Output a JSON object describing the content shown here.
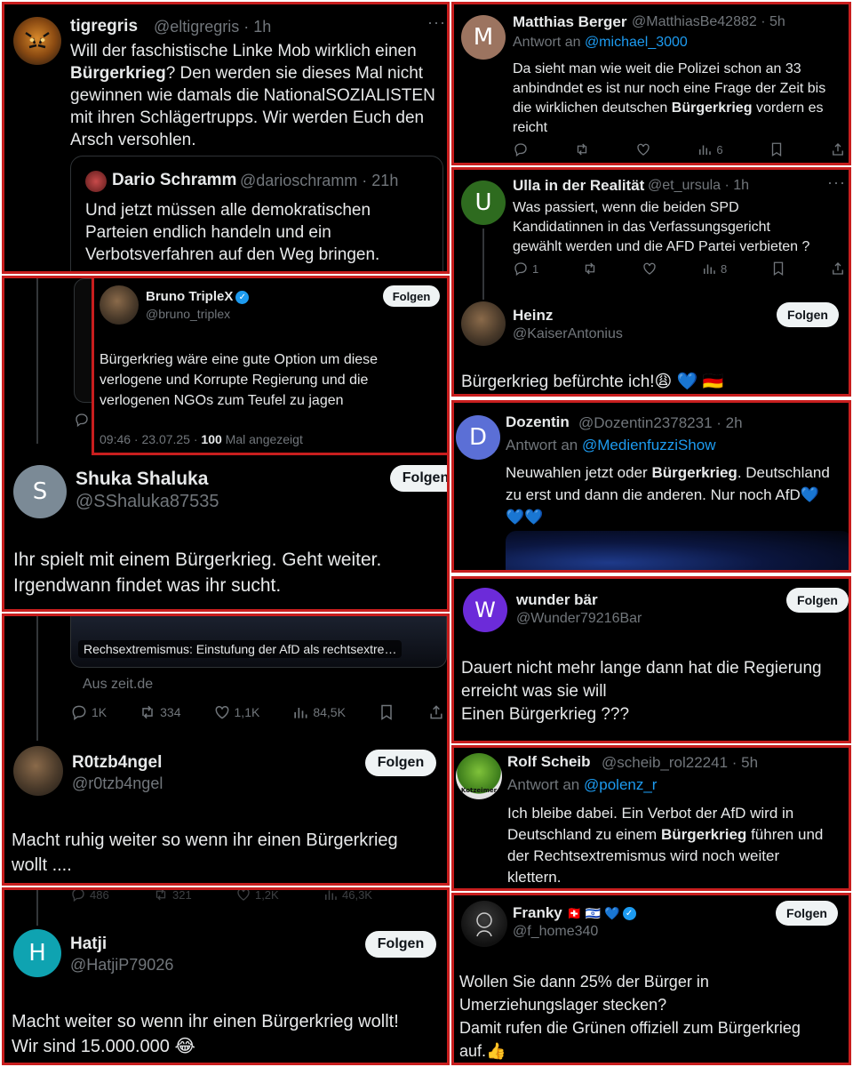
{
  "p1": {
    "name": "tigregris",
    "handle": "@eltigregris · 1h",
    "text_a": "Will der faschistische Linke Mob wirklich einen",
    "text_b_bold": "Bürgerkrieg",
    "text_b": "? Den werden sie dieses Mal nicht",
    "text_c": "gewinnen wie damals die NationalSOZIALISTEN",
    "text_d": "mit ihren Schlägertrupps. Wir werden Euch den",
    "text_e": "Arsch versohlen.",
    "quote": {
      "name": "Dario Schramm",
      "handle": "@darioschramm · 21h",
      "lines": [
        "Und jetzt müssen alle demokratischen",
        "Parteien endlich handeln und ein",
        "Verbotsverfahren auf den Weg bringen."
      ]
    }
  },
  "p2": {
    "name": "Matthias Berger",
    "handle": "@MatthiasBe42882 · 5h",
    "reply_prefix": "Antwort an",
    "reply_to": "@michael_3000",
    "avatar": "M",
    "line1": "Da sieht man wie weit die Polizei schon an 33",
    "line2": "anbindndet es ist nur noch eine Frage der Zeit bis",
    "line3a": "die wirklichen deutschen",
    "line3_bold": "Bürgerkrieg",
    "line3b": "vordern es",
    "line4": "reicht",
    "views": "6"
  },
  "p3": {
    "name": "Ulla in der Realität",
    "handle": "@et_ursula · 1h",
    "avatar": "U",
    "lines": [
      "Was passiert, wenn die beiden SPD",
      "Kandidatinnen in das Verfassungsgericht",
      "gewählt werden und die AFD Partei verbieten ?"
    ],
    "replies": "1",
    "views": "8",
    "reply_user": {
      "name": "Heinz",
      "handle": "@KaiserAntonius",
      "follow": "Folgen",
      "text": "Bürgerkrieg befürchte ich!😩 💙 🇩🇪"
    }
  },
  "p4": {
    "name": "Bruno TripleX",
    "handle": "@bruno_triplex",
    "follow": "Folgen",
    "lines": [
      "Bürgerkrieg wäre eine gute Option um diese",
      "verlogene und Korrupte Regierung und die",
      "verlogenen NGOs zum Teufel zu jagen"
    ],
    "meta_prefix": "09:46 · 23.07.25 ·",
    "meta_count": "100",
    "meta_suffix": "Mal angezeigt",
    "reply_user": {
      "name": "Shuka Shaluka",
      "handle": "@SShaluka87535",
      "avatar": "S",
      "follow": "Folgen",
      "lines": [
        "Ihr spielt mit einem Bürgerkrieg. Geht weiter.",
        "Irgendwann findet was ihr sucht."
      ]
    }
  },
  "p5": {
    "name": "Dozentin",
    "handle": "@Dozentin2378231 · 2h",
    "avatar": "D",
    "reply_prefix": "Antwort an",
    "reply_to": "@MedienfuzziShow",
    "line1a": "Neuwahlen jetzt oder",
    "line1_bold": "Bürgerkrieg",
    "line1b": ".  Deutschland",
    "line2": "zu erst und dann die anderen. Nur noch AfD💙",
    "line3": "💙💙"
  },
  "p6": {
    "card_title": "Rechsextremismus: Einstufung der AfD als rechtsextre…",
    "card_source": "Aus zeit.de",
    "replies": "1K",
    "reposts": "334",
    "likes": "1,1K",
    "views": "84,5K",
    "reply_user": {
      "name": "R0tzb4ngel",
      "handle": "@r0tzb4ngel",
      "follow": "Folgen",
      "lines": [
        "Macht ruhig weiter so wenn ihr einen Bürgerkrieg",
        "wollt ...."
      ]
    }
  },
  "p7": {
    "name": "wunder bär",
    "handle": "@Wunder79216Bar",
    "avatar": "W",
    "follow": "Folgen",
    "lines": [
      "Dauert nicht mehr lange dann hat die Regierung",
      "erreicht was sie will",
      "Einen Bürgerkrieg ???"
    ]
  },
  "p8": {
    "name": "Rolf Scheib",
    "handle": "@scheib_rol22241 · 5h",
    "reply_prefix": "Antwort an",
    "reply_to": "@polenz_r",
    "avatar_label": "Kotzeimer",
    "line1": "Ich bleibe dabei. Ein Verbot der AfD wird in",
    "line2a": "Deutschland zu einem",
    "line2_bold": "Bürgerkrieg",
    "line2b": "führen und",
    "line3": "der Rechtsextremismus wird noch weiter",
    "line4": "klettern."
  },
  "p9": {
    "stats": [
      "486",
      "321",
      "1,2K",
      "46,3K"
    ],
    "name": "Hatji",
    "handle": "@HatjiP79026",
    "avatar": "H",
    "follow": "Folgen",
    "lines": [
      "Macht weiter so wenn ihr einen Bürgerkrieg wollt!",
      "Wir sind 15.000.000 😂"
    ]
  },
  "p10": {
    "name": "Franky",
    "flags": "🇨🇭 🇮🇱 💙",
    "handle": "@f_home340",
    "follow": "Folgen",
    "lines": [
      "Wollen Sie dann 25% der Bürger in",
      "Umerziehungslager stecken?",
      "Damit rufen die Grünen offiziell zum Bürgerkrieg",
      "auf.👍"
    ]
  },
  "colors": {
    "border": "#c81e1e",
    "background": "#000000",
    "text": "#e7e9ea",
    "muted": "#71767b",
    "link": "#1d9bf0"
  }
}
